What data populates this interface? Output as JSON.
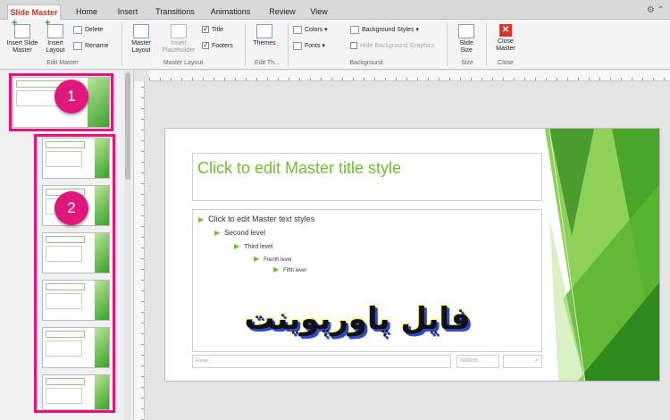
{
  "tabs": [
    "Slide Master",
    "Home",
    "Insert",
    "Transitions",
    "Animations",
    "Review",
    "View"
  ],
  "ribbon": {
    "insert_slide_master": "Insert Slide Master",
    "insert_layout": "Insert Layout",
    "delete": "Delete",
    "rename": "Rename",
    "group_edit_master": "Edit Master",
    "master_layout": "Master Layout",
    "insert_placeholder": "Insert Placeholder",
    "title_check": "Title",
    "footers_check": "Footers",
    "group_master_layout": "Master Layout",
    "themes": "Themes",
    "group_edit_theme": "Edit Th...",
    "colors": "Colors",
    "fonts": "Fonts",
    "background_styles": "Background Styles",
    "hide_background_graphics": "Hide Background Graphics",
    "group_background": "Background",
    "slide_size": "Slide Size",
    "group_size": "Size",
    "close_master": "Close Master",
    "group_close": "Close"
  },
  "badges": {
    "one": "1",
    "two": "2"
  },
  "slide": {
    "title": "Click to edit Master title style",
    "levels": [
      "Click to edit Master text styles",
      "Second level",
      "Third level",
      "Fourth level",
      "Fifth level"
    ],
    "footer": "Footer",
    "date": "00/00/15",
    "slide_num": "#"
  },
  "overlay_text": "فایل پاورپوینت",
  "colors": {
    "accent_pink": "#e2147c",
    "master_green": "#6cc12e"
  }
}
